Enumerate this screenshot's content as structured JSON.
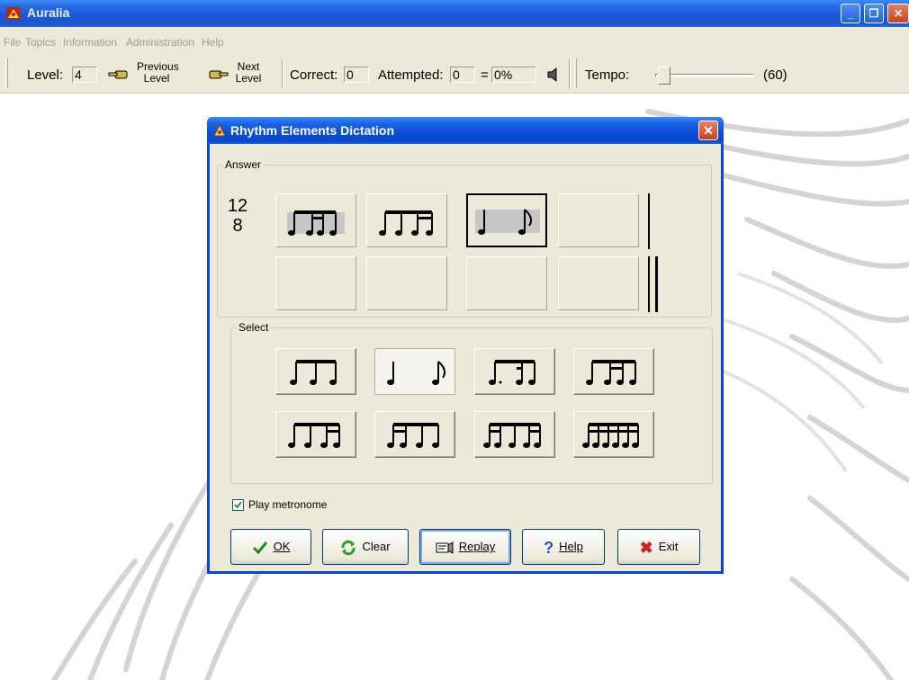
{
  "app": {
    "title": "Auralia",
    "window_controls": [
      "_",
      "❐",
      "✕"
    ]
  },
  "menu": {
    "items": [
      "File",
      "Topics",
      "Information",
      "Administration",
      "Help"
    ]
  },
  "toolbar": {
    "level_label": "Level:",
    "level_value": "4",
    "previous_level_line1": "Previous",
    "previous_level_line2": "Level",
    "next_level_line1": "Next",
    "next_level_line2": "Level",
    "correct_label": "Correct:",
    "correct_value": "0",
    "attempted_label": "Attempted:",
    "attempted_value": "0",
    "equals_label": "=",
    "percent_value": "0%",
    "tempo_label": "Tempo:",
    "tempo_value": "(60)",
    "tempo_slider_fraction": 0.0
  },
  "dialog": {
    "title": "Rhythm Elements Dictation",
    "close_label": "✕",
    "answer_group_label": "Answer",
    "time_signature_top": "12",
    "time_signature_bottom": "8",
    "answer_cells": [
      {
        "pattern": "quarter-two-sixteenths-eighth",
        "filled": true,
        "selected": false
      },
      {
        "pattern": "eighth-eighth-two-sixteenths",
        "filled": true,
        "selected": false
      },
      {
        "pattern": "quarter-eighth",
        "filled": true,
        "selected": true
      },
      {
        "pattern": "empty",
        "filled": false,
        "selected": false
      },
      {
        "pattern": "empty",
        "filled": false,
        "selected": false
      },
      {
        "pattern": "empty",
        "filled": false,
        "selected": false
      },
      {
        "pattern": "empty",
        "filled": false,
        "selected": false
      },
      {
        "pattern": "empty",
        "filled": false,
        "selected": false
      }
    ],
    "select_group_label": "Select",
    "select_patterns": [
      "three-eighths",
      "quarter-eighth",
      "dotted-eighth-sixteenth-eighth",
      "eighth-two-sixteenths-eighth",
      "eighth-eighth-two-sixteenths",
      "two-sixteenths-eighth-eighth",
      "two-sixteenths-eighth-two-sixteenths",
      "six-sixteenths"
    ],
    "pressed_select_index": 1,
    "play_metronome_label": "Play metronome",
    "play_metronome_checked": true,
    "buttons": {
      "ok": "OK",
      "clear": "Clear",
      "replay": "Replay",
      "help": "Help",
      "exit": "Exit"
    }
  },
  "colors": {
    "titlebar": "#1858d6",
    "dialog_face": "#ece9d8",
    "close_red": "#c94222"
  }
}
